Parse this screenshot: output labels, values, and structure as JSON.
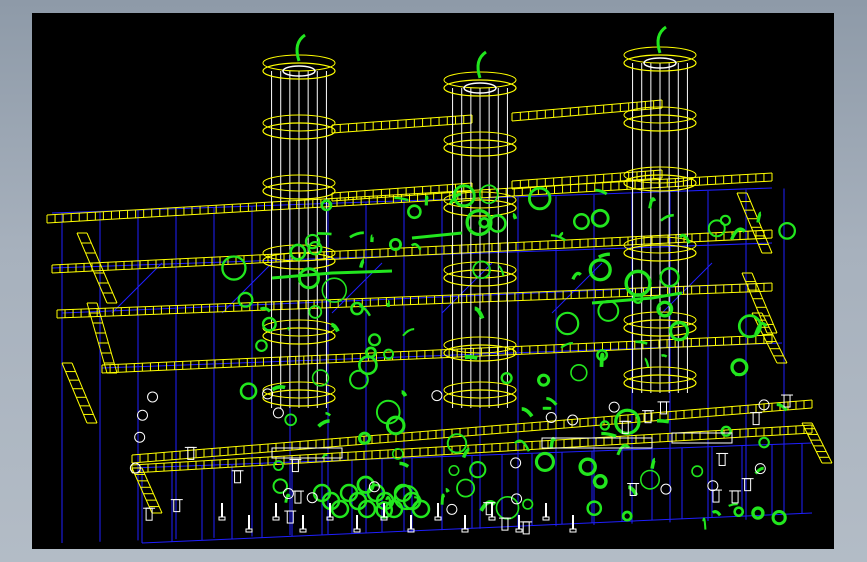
{
  "window": {
    "background": "#a7b1bd"
  },
  "drawing": {
    "background": "#000000",
    "colors": {
      "platform": "#ffff00",
      "structure": "#1f1fff",
      "piping": "#22e61e",
      "fittings": "#ffffff"
    },
    "towers": 3,
    "floor_levels": 4
  }
}
